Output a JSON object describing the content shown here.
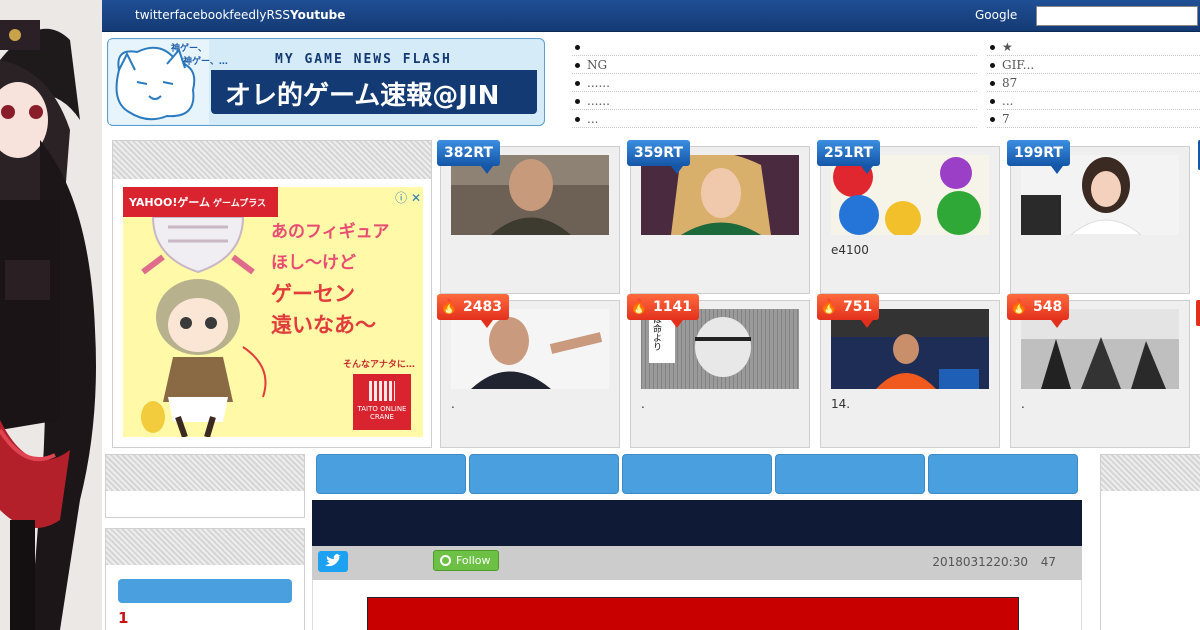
{
  "topbar": {
    "links": [
      "twitter",
      "facebook",
      "feedly",
      "RSS",
      "Youtube"
    ],
    "search_label": "Google",
    "search_value": ""
  },
  "logo": {
    "subtitle": "MY GAME NEWS FLASH",
    "title": "オレ的ゲーム速報@JIN",
    "mascot_text_1": "神ゲー、",
    "mascot_text_2": "神ゲー、…"
  },
  "top_links_left": [
    "",
    "NG",
    "......",
    "......",
    "..."
  ],
  "top_links_right": [
    "★",
    "GIF...",
    "87",
    "...",
    "7"
  ],
  "ad": {
    "brand_yahoo": "YAHOO!ゲーム",
    "brand_plus": "ゲームプラス",
    "info_icon": "ⓘ ✕",
    "copy_1": "あのフィギュア",
    "copy_2": "ほし～けど",
    "copy_3": "ゲーセン",
    "copy_4": "遠いなあ～",
    "sub": "そんなアナタに…",
    "taito": "TAITO ONLINE CRANE"
  },
  "cards_rt": [
    {
      "badge": "382RT",
      "caption": ""
    },
    {
      "badge": "359RT",
      "caption": ""
    },
    {
      "badge": "251RT",
      "caption": "e4100"
    },
    {
      "badge": "199RT",
      "caption": ""
    }
  ],
  "cards_hot": [
    {
      "badge": "2483",
      "caption": "."
    },
    {
      "badge": "1141",
      "caption": "."
    },
    {
      "badge": "751",
      "caption": "14."
    },
    {
      "badge": "548",
      "caption": "."
    }
  ],
  "manga_text": "ほ命より",
  "sidebar": {
    "rank_first": "1"
  },
  "share": {
    "follow_label": "Follow",
    "date": "2018031220:30",
    "count": "47"
  },
  "colors": {
    "topbar": "#143a73",
    "nav_button": "#4a9fdf",
    "rt_badge": "#1556a8",
    "hot_badge": "#e3301d",
    "article_header": "#0f1b36"
  }
}
